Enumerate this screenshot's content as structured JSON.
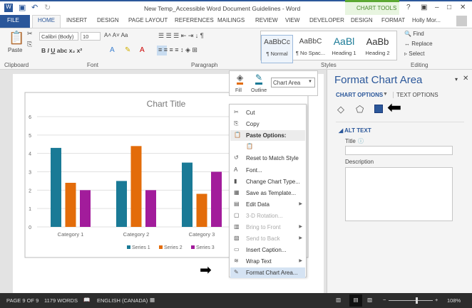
{
  "window": {
    "title": "New Temp_Accessible Word Document Guidelines - Word",
    "context_tab": "CHART TOOLS",
    "user": "Holly Mor..."
  },
  "tabs": [
    "FILE",
    "HOME",
    "INSERT",
    "DESIGN",
    "PAGE LAYOUT",
    "REFERENCES",
    "MAILINGS",
    "REVIEW",
    "VIEW",
    "DEVELOPER",
    "DESIGN",
    "FORMAT"
  ],
  "ribbon": {
    "paste": "Paste",
    "font_name": "Calibri (Body)",
    "font_size": "10",
    "styles": [
      {
        "preview": "AaBbCc",
        "name": "¶ Normal"
      },
      {
        "preview": "AaBbC",
        "name": "¶ No Spac..."
      },
      {
        "preview": "AaBl",
        "name": "Heading 1"
      },
      {
        "preview": "AaBb",
        "name": "Heading 2"
      }
    ],
    "find": "Find",
    "replace": "Replace",
    "select": "Select",
    "groups": [
      "Clipboard",
      "Font",
      "Paragraph",
      "Styles",
      "Editing"
    ]
  },
  "minitoolbar": {
    "fill": "Fill",
    "outline": "Outline",
    "element": "Chart Area"
  },
  "chart_data": {
    "type": "bar",
    "title": "Chart Title",
    "categories": [
      "Category 1",
      "Category 2",
      "Category 3"
    ],
    "ylim": [
      0,
      6
    ],
    "yticks": [
      "0",
      "1",
      "2",
      "3",
      "4",
      "5",
      "6"
    ],
    "grid": true,
    "legend": "bottom",
    "series": [
      {
        "name": "Series 1",
        "color": "#1a7a96",
        "values": [
          4.3,
          2.5,
          3.5
        ]
      },
      {
        "name": "Series 2",
        "color": "#e36c0a",
        "values": [
          2.4,
          4.4,
          1.8
        ]
      },
      {
        "name": "Series 3",
        "color": "#a21c9b",
        "values": [
          2,
          2,
          3
        ]
      }
    ]
  },
  "context_menu": [
    {
      "label": "Cut",
      "icon": "✂"
    },
    {
      "label": "Copy",
      "icon": "⎘"
    },
    {
      "label": "Paste Options:",
      "icon": "📋",
      "header": true
    },
    {
      "label": "",
      "icon": "📋"
    },
    {
      "label": "Reset to Match Style",
      "icon": "↺"
    },
    {
      "label": "Font...",
      "icon": "A"
    },
    {
      "label": "Change Chart Type...",
      "icon": "▮"
    },
    {
      "label": "Save as Template...",
      "icon": "▦"
    },
    {
      "label": "Edit Data",
      "icon": "▤",
      "sub": true
    },
    {
      "label": "3-D Rotation...",
      "icon": "▢",
      "disabled": true
    },
    {
      "label": "Bring to Front",
      "icon": "▥",
      "disabled": true,
      "sub": true
    },
    {
      "label": "Send to Back",
      "icon": "▧",
      "disabled": true,
      "sub": true
    },
    {
      "label": "Insert Caption...",
      "icon": "▭"
    },
    {
      "label": "Wrap Text",
      "icon": "≋",
      "sub": true
    },
    {
      "label": "Format Chart Area...",
      "icon": "✎",
      "highlight": true
    }
  ],
  "pane": {
    "title": "Format Chart Area",
    "tab1": "CHART OPTIONS",
    "tab2": "TEXT OPTIONS",
    "section": "ALT TEXT",
    "title_label": "Title",
    "description_label": "Description",
    "title_value": "",
    "description_value": ""
  },
  "status": {
    "page": "PAGE 9 OF 9",
    "words": "1179 WORDS",
    "language": "ENGLISH (CANADA)",
    "zoom": "108%",
    "zoom_percent": 108
  }
}
